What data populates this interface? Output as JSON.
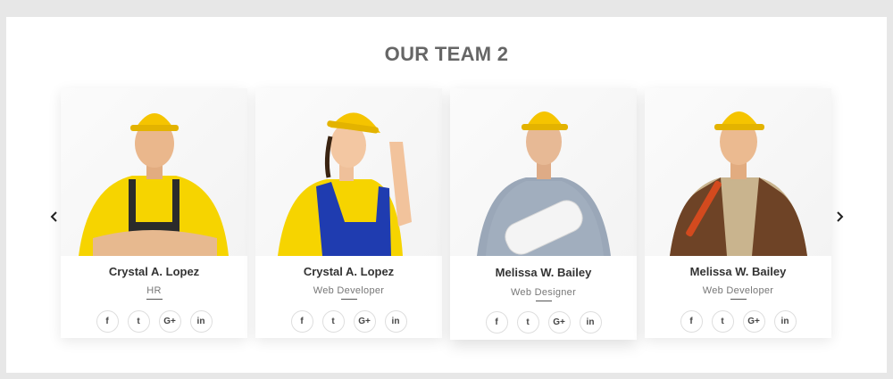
{
  "section": {
    "title": "OUR TEAM 2"
  },
  "navigation": {
    "prev_icon": "chevron-left-icon",
    "next_icon": "chevron-right-icon"
  },
  "members": [
    {
      "name": "Crystal A. Lopez",
      "role": "HR",
      "photo": "worker-yellow-shirt-overalls"
    },
    {
      "name": "Crystal A. Lopez",
      "role": "Web Developer",
      "photo": "worker-blue-overalls-saluting"
    },
    {
      "name": "Melissa W. Bailey",
      "role": "Web Designer",
      "photo": "worker-plaid-shirt-blueprints"
    },
    {
      "name": "Melissa W. Bailey",
      "role": "Web Developer",
      "photo": "worker-brown-jacket-wrench"
    }
  ],
  "social_icons": [
    {
      "icon": "facebook-icon",
      "glyph": "f"
    },
    {
      "icon": "twitter-icon",
      "glyph": "t"
    },
    {
      "icon": "google-plus-icon",
      "glyph": "G+"
    },
    {
      "icon": "linkedin-icon",
      "glyph": "in"
    }
  ],
  "colors": {
    "hard_hat": "#f5c400",
    "title": "#666666",
    "background": "#e7e7e7"
  }
}
